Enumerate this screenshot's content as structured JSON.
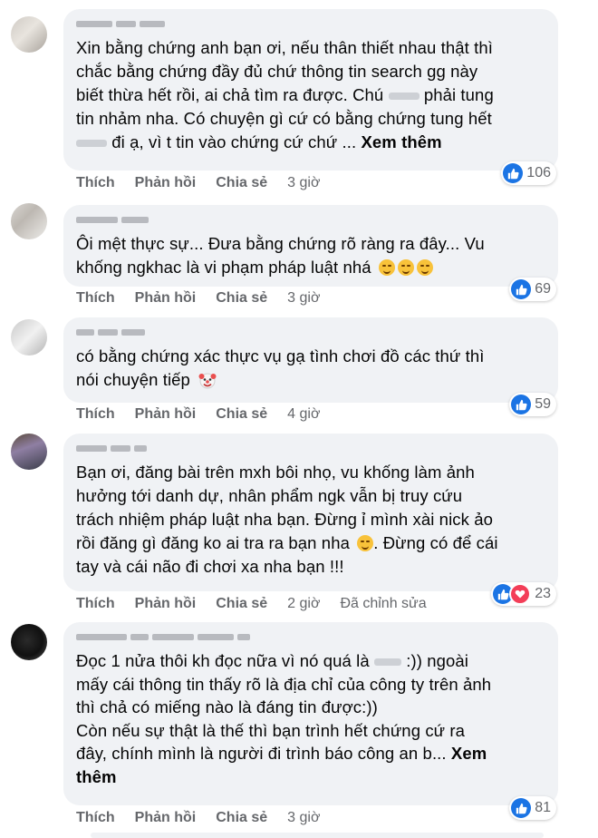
{
  "comments": [
    {
      "text_lines": [
        "Xin bằng chứng anh bạn ơi, nếu thân thiết nhau thật thì",
        "chắc bằng chứng đầy đủ chứ thông tin search gg này",
        "biết thừa hết rồi, ai chả tìm ra được. Chú",
        "phải tung",
        "tin nhảm nha. Có chuyện gì cứ có bằng chứng tung hết",
        "đi ạ, vì t tin vào chứng cứ chứ ..."
      ],
      "see_more": "Xem thêm",
      "reaction_count": "106",
      "time": "3 giờ"
    },
    {
      "text_lines": [
        "Ôi mệt thực sự... Đưa bằng chứng rõ ràng ra đây... Vu",
        "khống ngkhac là vi phạm pháp luật nhá"
      ],
      "reaction_count": "69",
      "time": "3 giờ"
    },
    {
      "text_lines": [
        "có bằng chứng xác thực vụ gạ tình chơi đồ các thứ thì",
        "nói chuyện tiếp"
      ],
      "reaction_count": "59",
      "time": "4 giờ"
    },
    {
      "text_lines": [
        "Bạn ơi, đăng bài trên mxh bôi nhọ, vu khống làm ảnh",
        "hưởng tới danh dự, nhân phẩm ngk vẫn bị truy cứu",
        "trách nhiệm pháp luật nha bạn. Đừng ỉ mình xài nick ảo",
        "rồi đăng gì đăng ko ai tra ra bạn nha",
        ". Đừng có để cái",
        "tay và cái não đi chơi xa nha bạn !!!"
      ],
      "reaction_count": "23",
      "time": "2 giờ",
      "edited": "Đã chỉnh sửa"
    },
    {
      "text_lines": [
        "Đọc 1 nửa thôi kh đọc nữa vì nó quá là",
        ":)) ngoài",
        "mấy cái thông tin thấy rõ là địa chỉ của công ty trên ảnh",
        "thì chả có miếng nào là đáng tin được:))",
        "Còn nếu sự thật là thế thì bạn trình hết chứng cứ ra",
        "đây, chính mình là người đi trình báo công an b..."
      ],
      "see_more_a": "Xem",
      "see_more_b": "thêm",
      "reaction_count": "81",
      "time": "3 giờ"
    }
  ],
  "actions": {
    "like": "Thích",
    "reply": "Phản hồi",
    "share": "Chia sẻ"
  },
  "colors": {
    "bubble": "#f0f2f5",
    "like_blue": "#1b74e4",
    "love_red": "#f33e58",
    "meta_gray": "#65676b"
  },
  "icons": [
    "like-reaction-icon",
    "love-reaction-icon",
    "smiling-face-icon",
    "clown-face-icon"
  ]
}
